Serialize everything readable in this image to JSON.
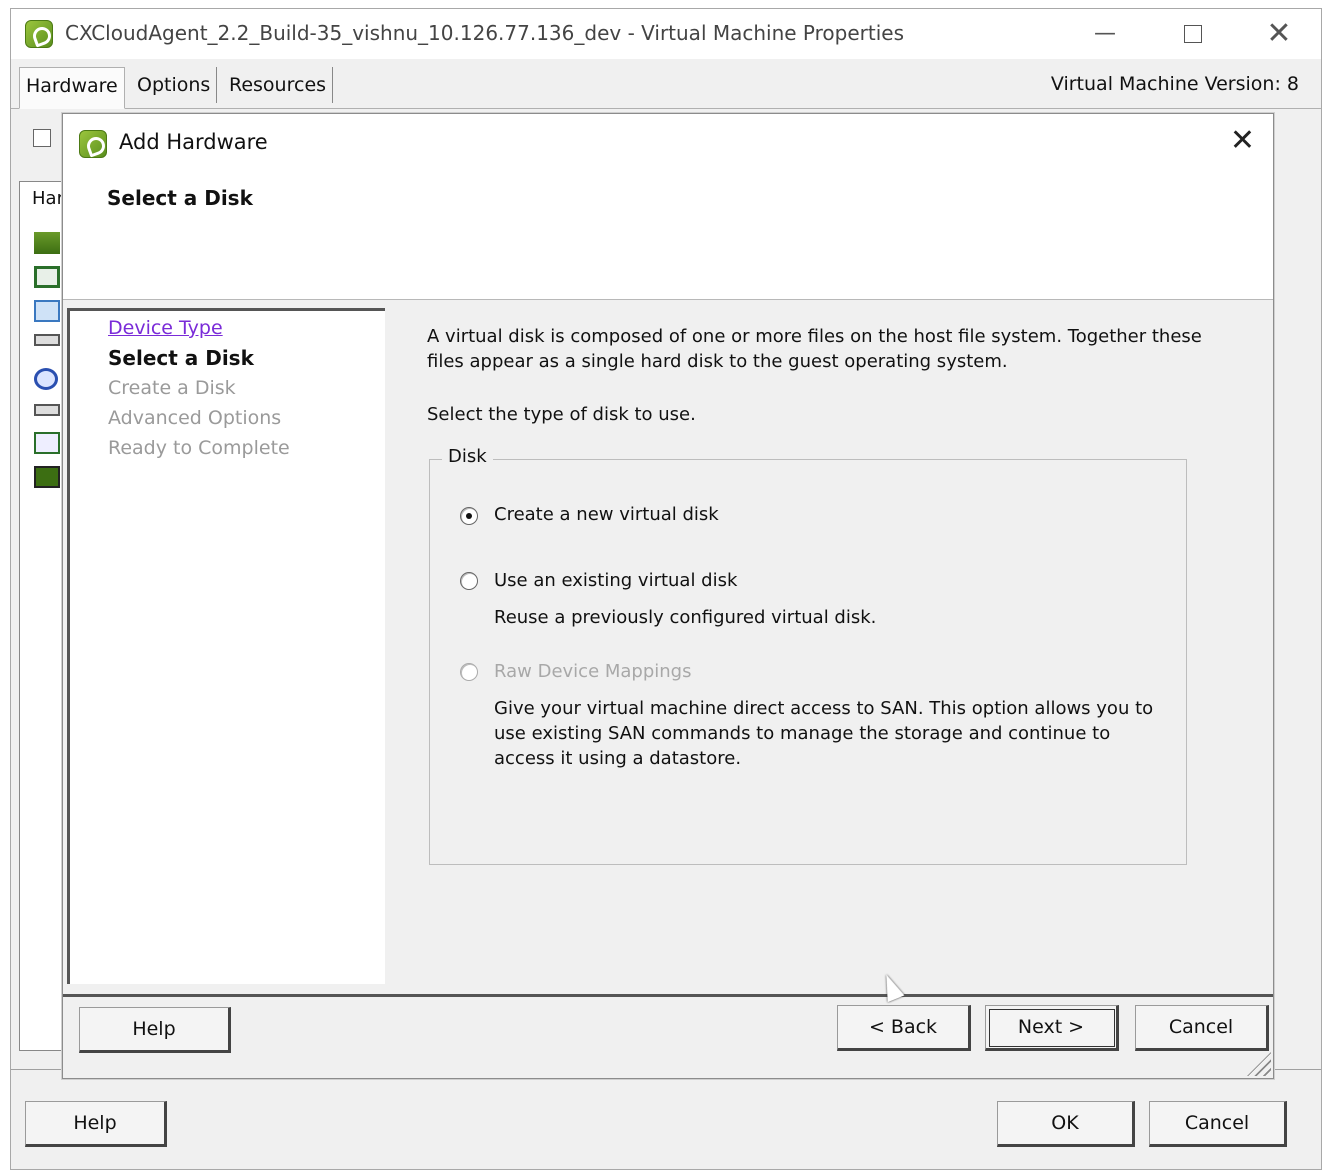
{
  "window": {
    "title": "CXCloudAgent_2.2_Build-35_vishnu_10.126.77.136_dev - Virtual Machine Properties",
    "minimize_glyph": "—",
    "close_glyph": "✕",
    "tabs": [
      "Hardware",
      "Options",
      "Resources"
    ],
    "vm_version": "Virtual Machine Version: 8",
    "background_list_header": "Har",
    "buttons": {
      "help": "Help",
      "ok": "OK",
      "cancel": "Cancel"
    }
  },
  "dialog": {
    "title": "Add Hardware",
    "close_glyph": "✕",
    "subtitle": "Select a Disk",
    "nav": {
      "device_type": "Device Type",
      "select_disk": "Select a Disk",
      "create_disk": "Create a Disk",
      "advanced_options": "Advanced Options",
      "ready_to_complete": "Ready to Complete"
    },
    "description": "A virtual disk is composed of one or more files on the host file system. Together these files appear as a single hard disk to the guest operating system.",
    "prompt": "Select the type of disk to use.",
    "group_label": "Disk",
    "options": {
      "create_new": {
        "label": "Create a new virtual disk",
        "selected": true
      },
      "use_existing": {
        "label": "Use an existing virtual disk",
        "desc": "Reuse a previously configured virtual disk.",
        "selected": false
      },
      "raw_device": {
        "label": "Raw Device Mappings",
        "desc": "Give your virtual machine direct access to SAN. This option allows you to use existing SAN commands to manage the storage and continue to access it using a datastore.",
        "selected": false,
        "enabled": false
      }
    },
    "buttons": {
      "help": "Help",
      "back": "< Back",
      "next": "Next >",
      "cancel": "Cancel"
    }
  },
  "colors": {
    "window_bg": "#f0f0f0",
    "link": "#7a2bd8",
    "disabled_text": "#9a9a9a",
    "brand_icon": "#7fb22e"
  },
  "icons": [
    "vsphere-app-icon",
    "minimize-icon",
    "maximize-icon",
    "close-icon",
    "mouse-cursor-icon"
  ]
}
